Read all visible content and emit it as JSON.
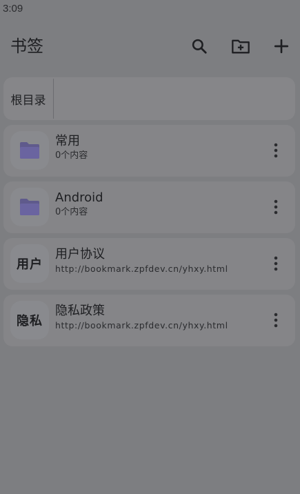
{
  "status_bar": {
    "time": "3:09"
  },
  "app_bar": {
    "title": "书签",
    "actions": [
      "search-icon",
      "new-folder-icon",
      "add-icon"
    ]
  },
  "breadcrumb": {
    "root_label": "根目录"
  },
  "items": [
    {
      "type": "folder",
      "icon": "folder-icon",
      "title": "常用",
      "subtitle": "0个内容"
    },
    {
      "type": "folder",
      "icon": "folder-icon",
      "title": "Android",
      "subtitle": "0个内容"
    },
    {
      "type": "bookmark",
      "thumb_text": "用户",
      "title": "用户协议",
      "subtitle": "http://bookmark.zpfdev.cn/yhxy.html"
    },
    {
      "type": "bookmark",
      "thumb_text": "隐私",
      "title": "隐私政策",
      "subtitle": "http://bookmark.zpfdev.cn/yhxy.html"
    }
  ],
  "colors": {
    "background": "#7d7e81",
    "card": "#858588",
    "folder_accent": "#5f5a8c"
  }
}
